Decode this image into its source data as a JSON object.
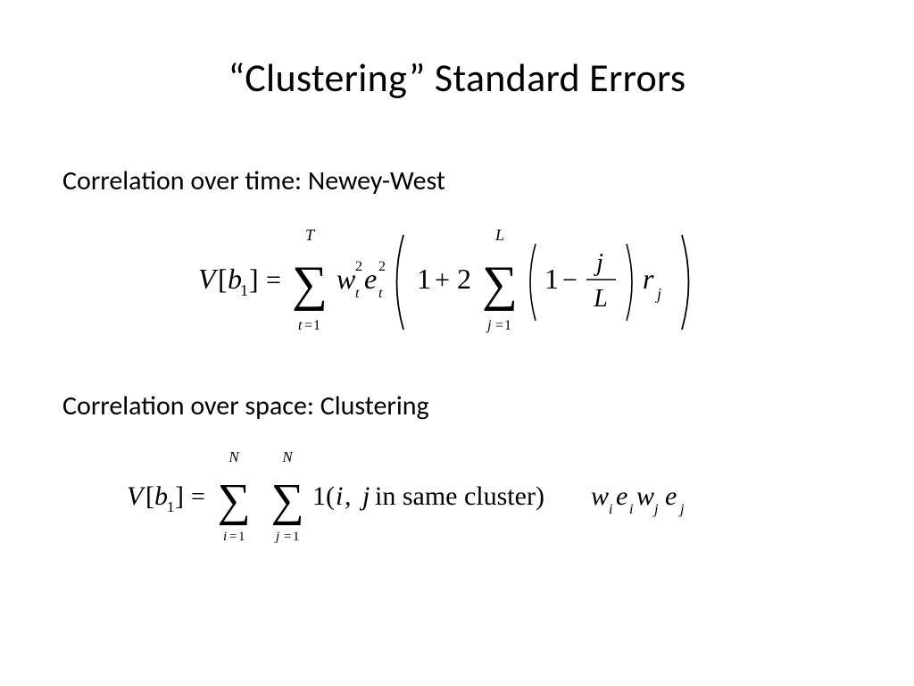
{
  "title": "“Clustering” Standard Errors",
  "section1": "Correlation over time: Newey-West",
  "section2": "Correlation over space: Clustering",
  "formula1": {
    "lhs_V": "V",
    "lhs_b": "b",
    "lhs_sub": "1",
    "eq": "=",
    "sum1_top": "T",
    "sum1_bot_var": "t",
    "sum1_bot_eq": "=",
    "sum1_bot_n": "1",
    "w": "w",
    "w_sub": "t",
    "w_sup": "2",
    "e": "e",
    "e_sub": "t",
    "e_sup": "2",
    "one": "1",
    "plus": "+",
    "two": "2",
    "sum2_top": "L",
    "sum2_bot_var": "j",
    "sum2_bot_eq": "=",
    "sum2_bot_n": "1",
    "inner_one": "1",
    "minus": "−",
    "frac_num": "j",
    "frac_den": "L",
    "r": "r",
    "r_sub": "j"
  },
  "formula2": {
    "lhs_V": "V",
    "lhs_b": "b",
    "lhs_sub": "1",
    "eq": "=",
    "sum1_top": "N",
    "sum1_bot_var": "i",
    "sum1_bot_eq": "=",
    "sum1_bot_n": "1",
    "sum2_top": "N",
    "sum2_bot_var": "j",
    "sum2_bot_eq": "=",
    "sum2_bot_n": "1",
    "indicator_1": "1(",
    "i": "i",
    "comma": ",",
    "j": "j",
    "text": " in  same cluster)",
    "w1": "w",
    "w1_sub": "i",
    "e1": "e",
    "e1_sub": "i",
    "w2": "w",
    "w2_sub": "j",
    "e2": "e",
    "e2_sub": "j"
  }
}
